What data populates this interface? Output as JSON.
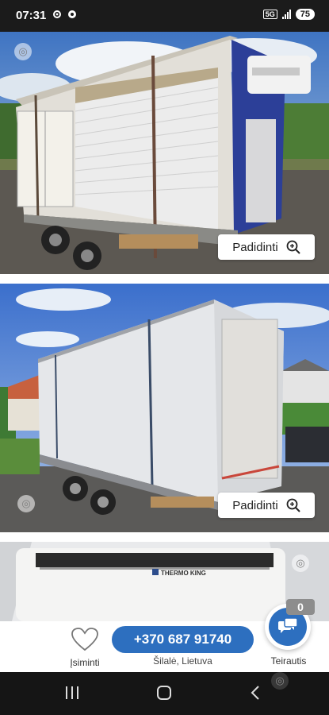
{
  "status_bar": {
    "time": "07:31",
    "network": "5G",
    "battery": "75"
  },
  "photos": [
    {
      "zoom_label": "Padidinti"
    },
    {
      "zoom_label": "Padidinti"
    }
  ],
  "thermo_label": "THERMO KING",
  "actions": {
    "favorite_label": "Įsiminti",
    "phone": "+370 687 91740",
    "location": "Šilalė, Lietuva",
    "ask_label": "Teirautis",
    "chat_count": "0"
  },
  "colors": {
    "accent": "#2d6fbf",
    "status_bar": "#1b1b1b",
    "nav_bar": "#151515"
  }
}
